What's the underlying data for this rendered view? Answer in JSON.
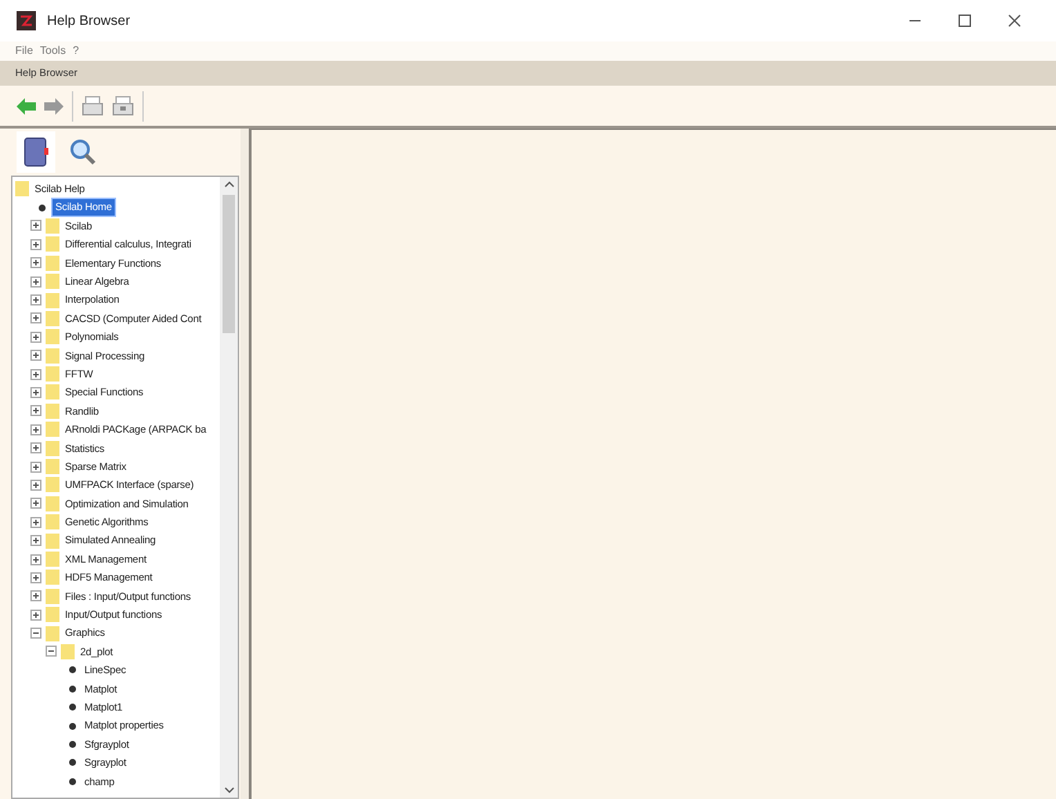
{
  "window": {
    "title": "Help Browser"
  },
  "menu": [
    "File",
    "Tools",
    "?"
  ],
  "panel_title": "Help Browser",
  "tree": [
    {
      "kind": "folder",
      "label": "Scilab Help",
      "children": [
        {
          "kind": "page",
          "label": "Scilab Home",
          "selected": true
        },
        {
          "kind": "folder",
          "label": "Scilab",
          "expanded": false
        },
        {
          "kind": "folder",
          "label": "Differential calculus, Integrati",
          "expanded": false
        },
        {
          "kind": "folder",
          "label": "Elementary Functions",
          "expanded": false
        },
        {
          "kind": "folder",
          "label": "Linear Algebra",
          "expanded": false
        },
        {
          "kind": "folder",
          "label": "Interpolation",
          "expanded": false
        },
        {
          "kind": "folder",
          "label": "CACSD (Computer Aided Cont",
          "expanded": false
        },
        {
          "kind": "folder",
          "label": "Polynomials",
          "expanded": false
        },
        {
          "kind": "folder",
          "label": "Signal Processing",
          "expanded": false
        },
        {
          "kind": "folder",
          "label": "FFTW",
          "expanded": false
        },
        {
          "kind": "folder",
          "label": "Special Functions",
          "expanded": false
        },
        {
          "kind": "folder",
          "label": "Randlib",
          "expanded": false
        },
        {
          "kind": "folder",
          "label": "ARnoldi PACKage (ARPACK ba",
          "expanded": false
        },
        {
          "kind": "folder",
          "label": "Statistics",
          "expanded": false
        },
        {
          "kind": "folder",
          "label": "Sparse Matrix",
          "expanded": false
        },
        {
          "kind": "folder",
          "label": "UMFPACK Interface (sparse)",
          "expanded": false
        },
        {
          "kind": "folder",
          "label": "Optimization and Simulation",
          "expanded": false
        },
        {
          "kind": "folder",
          "label": "Genetic Algorithms",
          "expanded": false
        },
        {
          "kind": "folder",
          "label": "Simulated Annealing",
          "expanded": false
        },
        {
          "kind": "folder",
          "label": "XML Management",
          "expanded": false
        },
        {
          "kind": "folder",
          "label": "HDF5 Management",
          "expanded": false
        },
        {
          "kind": "folder",
          "label": "Files : Input/Output functions",
          "expanded": false
        },
        {
          "kind": "folder",
          "label": "Input/Output functions",
          "expanded": false
        },
        {
          "kind": "folder",
          "label": "Graphics",
          "expanded": true,
          "children": [
            {
              "kind": "folder",
              "label": "2d_plot",
              "expanded": true,
              "children": [
                {
                  "kind": "page",
                  "label": "LineSpec",
                  "selected": false
                },
                {
                  "kind": "page",
                  "label": "Matplot",
                  "selected": false
                },
                {
                  "kind": "page",
                  "label": "Matplot1",
                  "selected": false
                },
                {
                  "kind": "page",
                  "label": "Matplot properties",
                  "selected": false
                },
                {
                  "kind": "page",
                  "label": "Sfgrayplot",
                  "selected": false
                },
                {
                  "kind": "page",
                  "label": "Sgrayplot",
                  "selected": false
                },
                {
                  "kind": "page",
                  "label": "champ",
                  "selected": false
                }
              ]
            }
          ]
        }
      ]
    }
  ]
}
